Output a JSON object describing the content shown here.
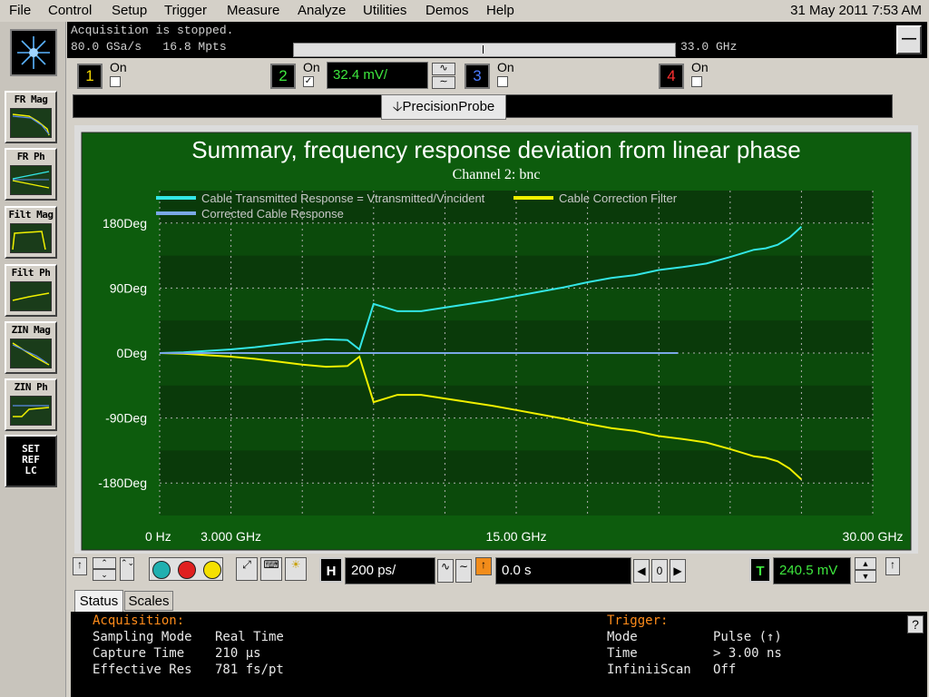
{
  "menu": [
    "File",
    "Control",
    "Setup",
    "Trigger",
    "Measure",
    "Analyze",
    "Utilities",
    "Demos",
    "Help"
  ],
  "datetime": "31 May 2011   7:53 AM",
  "acquisition": {
    "status": "Acquisition is stopped.",
    "rate_line": "80.0 GSa/s   16.8 Mpts",
    "bandwidth": "33.0 GHz"
  },
  "channels": [
    {
      "num": "1",
      "on_label": "On",
      "checked": false,
      "color": "#f5d800"
    },
    {
      "num": "2",
      "on_label": "On",
      "checked": true,
      "color": "#3ee83e",
      "scale": "32.4 mV/"
    },
    {
      "num": "3",
      "on_label": "On",
      "checked": false,
      "color": "#4b7bff"
    },
    {
      "num": "4",
      "on_label": "On",
      "checked": false,
      "color": "#ff3030"
    }
  ],
  "probe_tab": "PrecisionProbe",
  "side_buttons": [
    {
      "label": "FR Mag",
      "icon": "fr-mag-icon"
    },
    {
      "label": "FR Ph",
      "icon": "fr-ph-icon"
    },
    {
      "label": "Filt Mag",
      "icon": "filt-mag-icon"
    },
    {
      "label": "Filt Ph",
      "icon": "filt-ph-icon"
    },
    {
      "label": "ZIN Mag",
      "icon": "zin-mag-icon"
    },
    {
      "label": "ZIN Ph",
      "icon": "zin-ph-icon"
    }
  ],
  "setref": [
    "SET",
    "REF",
    "LC"
  ],
  "chart_data": {
    "type": "line",
    "title": "Summary, frequency response deviation from linear phase",
    "subtitle": "Channel 2: bnc",
    "xlabel": "",
    "ylabel": "",
    "x_unit": "GHz",
    "xlim": [
      0,
      30
    ],
    "ylim": [
      -225,
      225
    ],
    "x_tick_labels": [
      "0 Hz",
      "3.000 GHz",
      "15.00 GHz",
      "30.00 GHz"
    ],
    "x_ticks": [
      0,
      3,
      15,
      30
    ],
    "y_tick_labels": [
      "180Deg",
      "90Deg",
      "0Deg",
      "-90Deg",
      "-180Deg"
    ],
    "y_ticks": [
      180,
      90,
      0,
      -90,
      -180
    ],
    "grid": true,
    "legend": "top-left",
    "colors": {
      "background": "#0d5c0d",
      "plot_area": "#0a3a0a",
      "grid": "#b0b0b0"
    },
    "series": [
      {
        "name": "Cable Transmitted Response = Vtransmitted/Vincident",
        "color": "#33e6e6",
        "x": [
          0,
          1,
          2,
          3,
          4,
          5,
          6,
          7,
          7.9,
          8.4,
          9,
          10,
          11,
          12,
          13,
          14,
          15,
          16,
          17,
          18,
          19,
          20,
          21,
          22,
          23,
          24,
          25,
          25.5,
          26,
          26.5,
          27
        ],
        "y": [
          0,
          1,
          3,
          5,
          8,
          12,
          16,
          19,
          18,
          5,
          68,
          58,
          58,
          63,
          68,
          73,
          79,
          85,
          91,
          98,
          104,
          108,
          115,
          119,
          124,
          133,
          143,
          145,
          150,
          160,
          175
        ]
      },
      {
        "name": "Cable Correction Filter",
        "color": "#f0f000",
        "x": [
          0,
          1,
          2,
          3,
          4,
          5,
          6,
          7,
          7.9,
          8.4,
          9,
          10,
          11,
          12,
          13,
          14,
          15,
          16,
          17,
          18,
          19,
          20,
          21,
          22,
          23,
          24,
          25,
          25.5,
          26,
          26.5,
          27
        ],
        "y": [
          0,
          -1,
          -3,
          -5,
          -8,
          -12,
          -16,
          -19,
          -18,
          -5,
          -68,
          -58,
          -58,
          -63,
          -68,
          -73,
          -79,
          -85,
          -91,
          -98,
          -104,
          -108,
          -115,
          -119,
          -124,
          -133,
          -143,
          -145,
          -150,
          -160,
          -175
        ]
      },
      {
        "name": "Corrected Cable Response",
        "color": "#7aa8e6",
        "x": [
          0,
          3,
          6,
          9,
          12,
          15,
          18,
          21,
          21.8
        ],
        "y": [
          0,
          0,
          0,
          0,
          0,
          0,
          0,
          0,
          0
        ]
      }
    ]
  },
  "controls": {
    "h_label": "H",
    "timebase": "200 ps/",
    "delay": "0.0 s",
    "delay_ref": "0",
    "t_label": "T",
    "trigger_level": "240.5 mV"
  },
  "tabs": {
    "status": "Status",
    "scales": "Scales"
  },
  "status": {
    "acq_header": "Acquisition:",
    "acq_rows": [
      [
        "Sampling Mode",
        "Real Time"
      ],
      [
        "Capture Time",
        "210 µs"
      ],
      [
        "Effective Res",
        "781 fs/pt"
      ]
    ],
    "trig_header": "Trigger:",
    "trig_rows": [
      [
        "Mode",
        "Pulse (↑)"
      ],
      [
        "Time",
        "> 3.00 ns"
      ],
      [
        "InfiniiScan",
        "Off"
      ]
    ]
  },
  "help_label": "?"
}
